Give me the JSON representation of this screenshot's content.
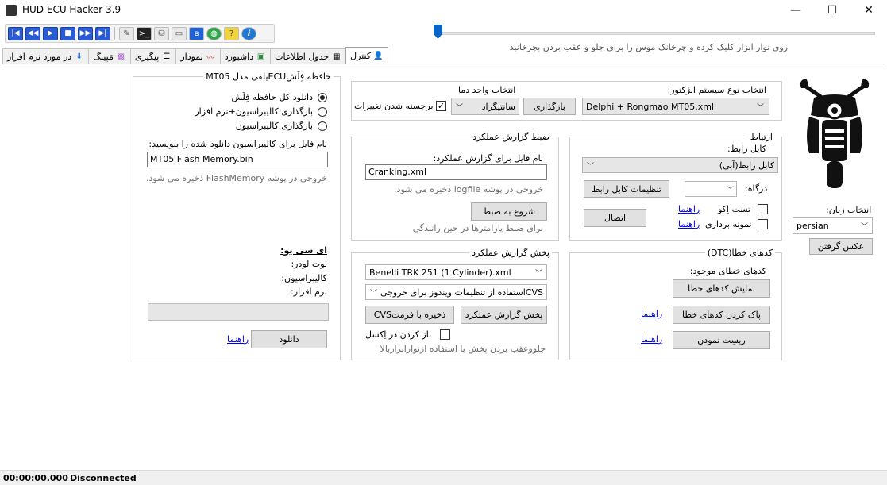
{
  "window": {
    "title": "HUD ECU Hacker 3.9",
    "minimize": "—",
    "maximize": "☐",
    "close": "✕"
  },
  "toolbar": {
    "first": "|◀",
    "rewind": "◀◀",
    "play": "▶",
    "stop": "■",
    "forward": "▶▶",
    "last": "▶|",
    "tool": "✎",
    "terminal": ">_",
    "db": "⛁",
    "device": "▭",
    "bluetooth": "ʙ",
    "globe": "◍",
    "help": "?",
    "info": "i"
  },
  "slider": {
    "hint": "روی نوار ابزار کلیک کرده و چرخانک موس را برای جلو و عقب بردن بچرخانید"
  },
  "tabs": [
    {
      "label": "کنترل",
      "icon": "user-icon",
      "active": true
    },
    {
      "label": "جدول اطلاعات",
      "icon": "table-icon"
    },
    {
      "label": "داشبورد",
      "icon": "dashboard-icon"
    },
    {
      "label": "نمودار",
      "icon": "chart-icon"
    },
    {
      "label": "پیگیری",
      "icon": "list-icon"
    },
    {
      "label": "مَپینگ",
      "icon": "grid-icon"
    },
    {
      "label": "در مورد نرم افزار",
      "icon": "download-icon"
    }
  ],
  "ecu_type": {
    "label": "انتخاب نوع سیستم انژکتور:",
    "selected": "Delphi + Rongmao MT05.xml",
    "load_button": "بارگذاری",
    "unit_label": "انتخاب واحد دما",
    "unit_selected": "سانتیگراد",
    "highlight_label": "برجسته شدن تغییرات",
    "highlight_checked": "✓"
  },
  "connection": {
    "title": "ارتباط",
    "cable_label": "کابل رابط:",
    "cable_selected": "کابل رابط(آبی)",
    "settings_button": "تنظیمات کابل رابط",
    "port_label": "درگاه:",
    "connect_button": "اتصال",
    "echo_test_label": "تست اِکو",
    "sampling_label": "نمونه برداری",
    "help_link": "راهنما"
  },
  "recording": {
    "title": "ضبط گزارش عملکرد",
    "filename_label": "نام فایل برای گزارش عملکرد:",
    "filename_value": "Cranking.xml",
    "output_hint": "خروجی در پوشه logfile ذخیره می شود.",
    "start_button": "شروع به ضبط",
    "start_hint": "برای ضبط پارامترها در حین رانندگی"
  },
  "flash": {
    "title": "حافظه فِلَشECUیلفی مدل MT05",
    "option_full": "دانلود کل حافظه فِلَش",
    "option_cal_sw": "بارگذاری کالیبراسیون+نرم افزار",
    "option_cal": "بارگذاری کالیبراسیون",
    "filename_label": "نام فایل برای کالیبراسیون دانلود شده را بنویسید:",
    "filename_value": "MT05 Flash Memory.bin",
    "output_hint": "خروجی در پوشه FlashMemory ذخیره می شود.",
    "ecu_heading": "ای سی یو:",
    "bootloader_label": "بوت لودر:",
    "calibration_label": "کالیبراسیون:",
    "software_label": "نرم افزار:",
    "download_button": "دانلود",
    "help_link": "راهنما"
  },
  "playback": {
    "title": "پخش گزارش عملکرد",
    "file_selected": "Benelli TRK 251 (1 Cylinder).xml",
    "csv_selected": "استفاده از تنظیمات ویندوز برای خروجیCVS",
    "play_button": "پخش گزارش عملکرد",
    "save_csv_button": "ذخیره با فرمتCVS",
    "open_excel_label": "باز کردن در اِکسل",
    "hint": "جلووعقب بردن پخش با استفاده ازنوارابزاربالا"
  },
  "dtc": {
    "title": "کدهای خطا(DTC)",
    "existing_label": "کدهای خطای موجود:",
    "show_button": "نمایش کدهای خطا",
    "clear_button": "پاک کردن کدهای خطا",
    "reset_button": "ریسِت نمودن",
    "help_link": "راهنما"
  },
  "sidebar": {
    "language_label": "انتخاب زبان:",
    "language_selected": "persian",
    "screenshot_button": "عکس گرفتن"
  },
  "status": {
    "time": "00:00:00.000",
    "state": "Disconnected"
  }
}
